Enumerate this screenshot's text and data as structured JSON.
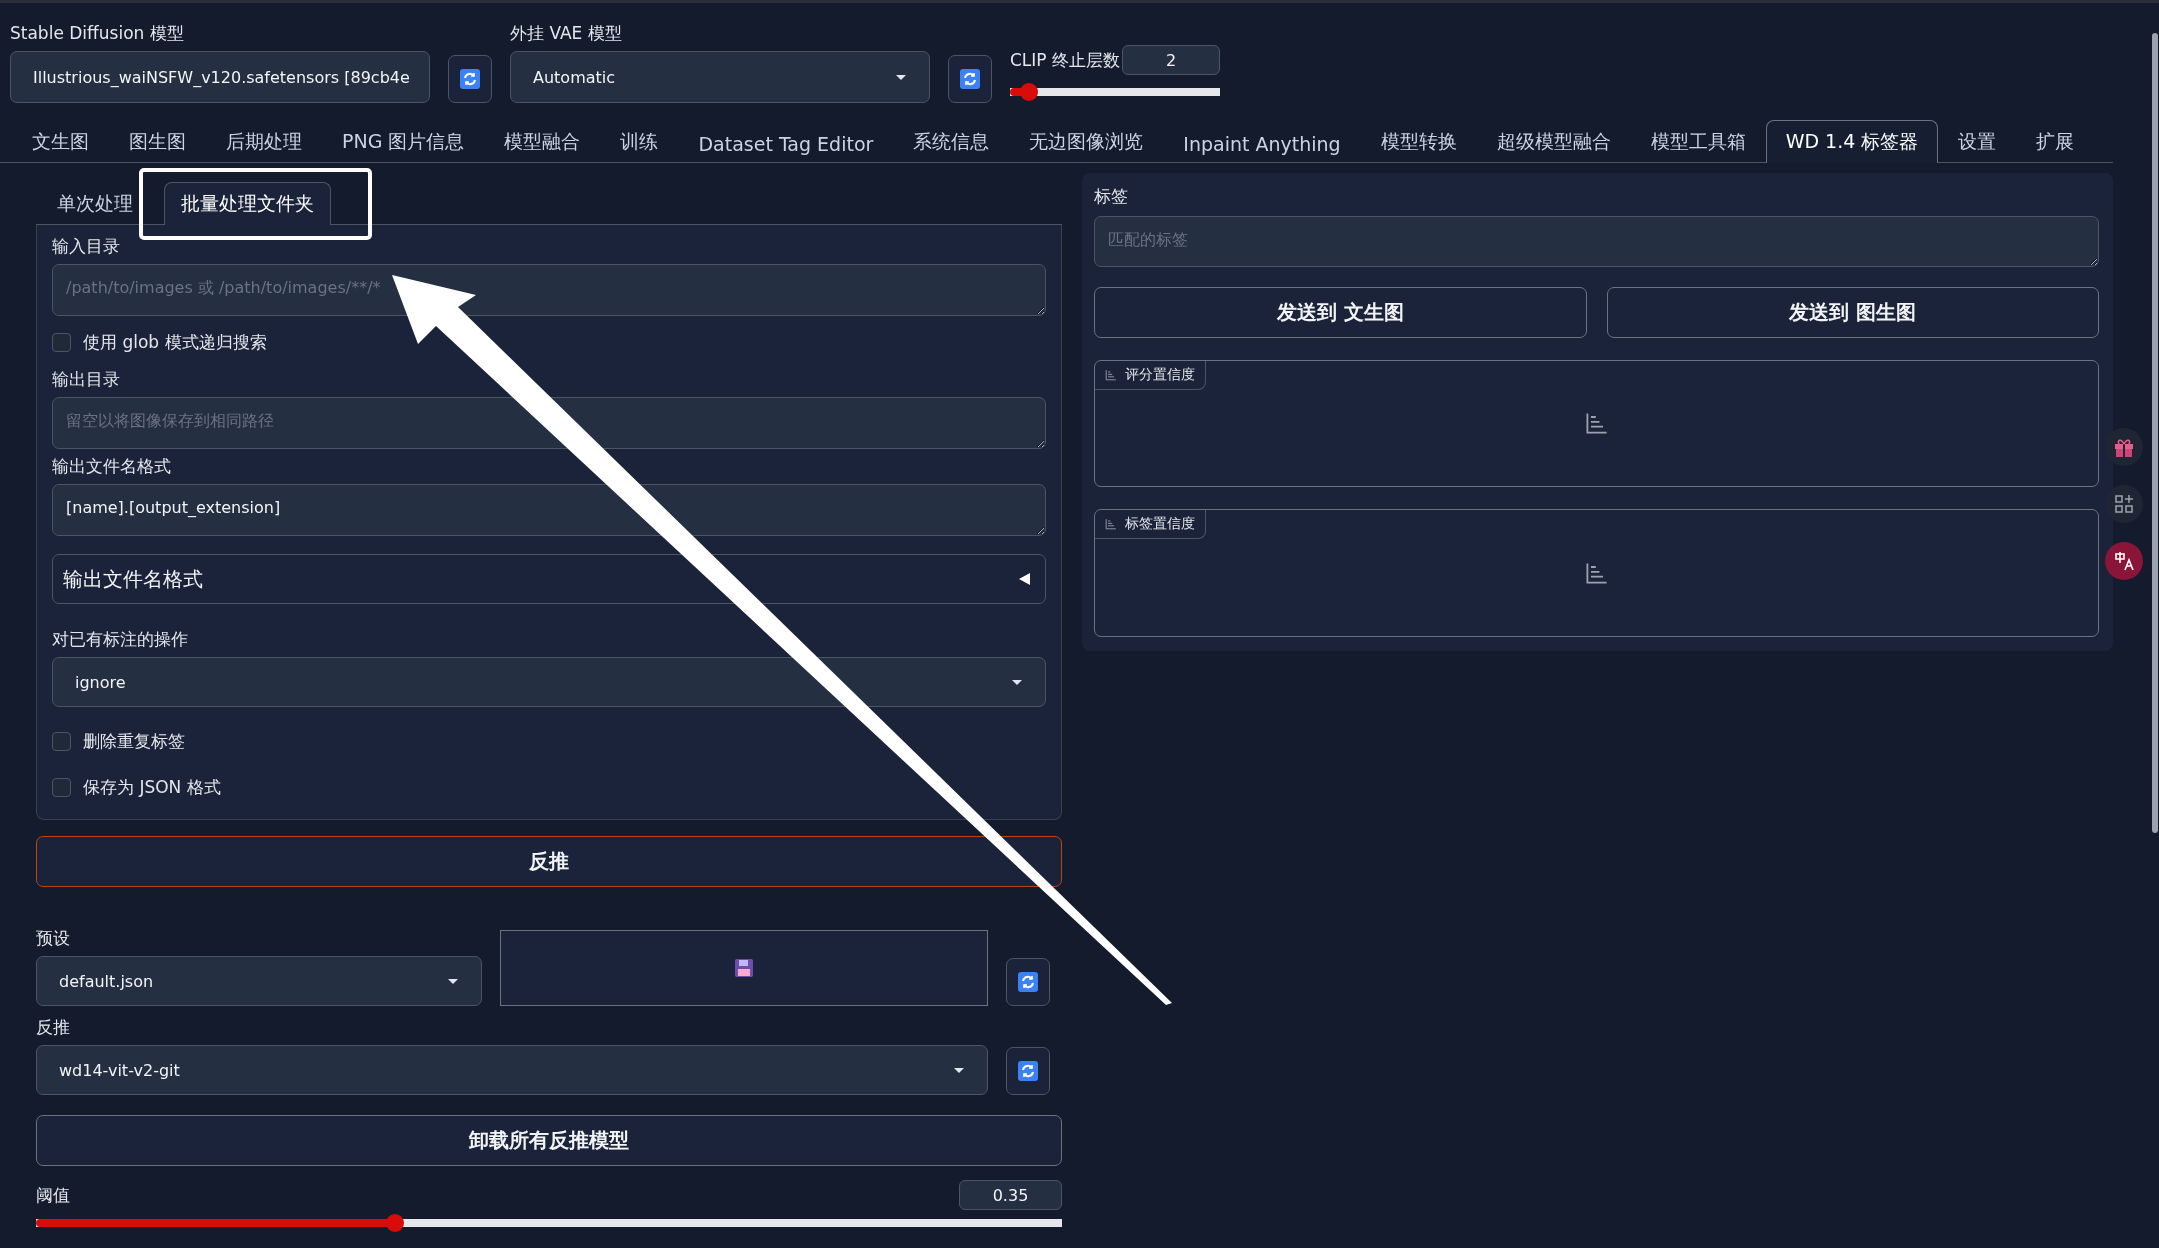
{
  "top": {
    "model": {
      "label": "Stable Diffusion 模型",
      "value": "Illustrious_waiNSFW_v120.safetensors [89cb4e"
    },
    "vae": {
      "label": "外挂 VAE 模型",
      "value": "Automatic"
    },
    "clip": {
      "label": "CLIP 终止层数",
      "value": "2",
      "level": 0.09
    }
  },
  "tabs": [
    {
      "label": "文生图",
      "selected": false
    },
    {
      "label": "图生图",
      "selected": false
    },
    {
      "label": "后期处理",
      "selected": false
    },
    {
      "label": "PNG 图片信息",
      "selected": false
    },
    {
      "label": "模型融合",
      "selected": false
    },
    {
      "label": "训练",
      "selected": false
    },
    {
      "label": "Dataset Tag Editor",
      "selected": false
    },
    {
      "label": "系统信息",
      "selected": false
    },
    {
      "label": "无边图像浏览",
      "selected": false
    },
    {
      "label": "Inpaint Anything",
      "selected": false
    },
    {
      "label": "模型转换",
      "selected": false
    },
    {
      "label": "超级模型融合",
      "selected": false
    },
    {
      "label": "模型工具箱",
      "selected": false
    },
    {
      "label": "WD 1.4 标签器",
      "selected": true
    },
    {
      "label": "设置",
      "selected": false
    },
    {
      "label": "扩展",
      "selected": false
    }
  ],
  "subtabs": [
    {
      "label": "单次处理",
      "selected": false
    },
    {
      "label": "批量处理文件夹",
      "selected": true
    }
  ],
  "items": [
    {
      "kind": "textarea",
      "label": "输入目录",
      "placeholder": "/path/to/images 或 /path/to/images/**/*"
    },
    {
      "kind": "checkbox",
      "label": "使用 glob 模式递归搜索",
      "checked": false
    },
    {
      "kind": "textarea",
      "label": "输出目录",
      "placeholder": "留空以将图像保存到相同路径"
    },
    {
      "kind": "textarea",
      "label": "输出文件名格式",
      "value": "[name].[output_extension]"
    },
    {
      "kind": "accordion",
      "label": "输出文件名格式",
      "expanded": false
    },
    {
      "kind": "dropdown",
      "label": "对已有标注的操作",
      "value": "ignore"
    },
    {
      "kind": "checkbox",
      "label": "删除重复标签",
      "checked": false
    },
    {
      "kind": "checkbox",
      "label": "保存为 JSON 格式",
      "checked": false
    }
  ],
  "interrogate_button": "反推",
  "preset": {
    "label": "预设",
    "value": "default.json"
  },
  "interrogator": {
    "label": "反推",
    "value": "wd14-vit-v2-git"
  },
  "unload_button": "卸载所有反推模型",
  "threshold": {
    "label": "阈值",
    "value": "0.35",
    "level": 0.35
  },
  "right": {
    "tags": {
      "label": "标签",
      "placeholder": "匹配的标签"
    },
    "send_buttons": [
      "发送到 文生图",
      "发送到 图生图"
    ],
    "label_panels": [
      {
        "title": "评分置信度"
      },
      {
        "title": "标签置信度"
      }
    ]
  }
}
